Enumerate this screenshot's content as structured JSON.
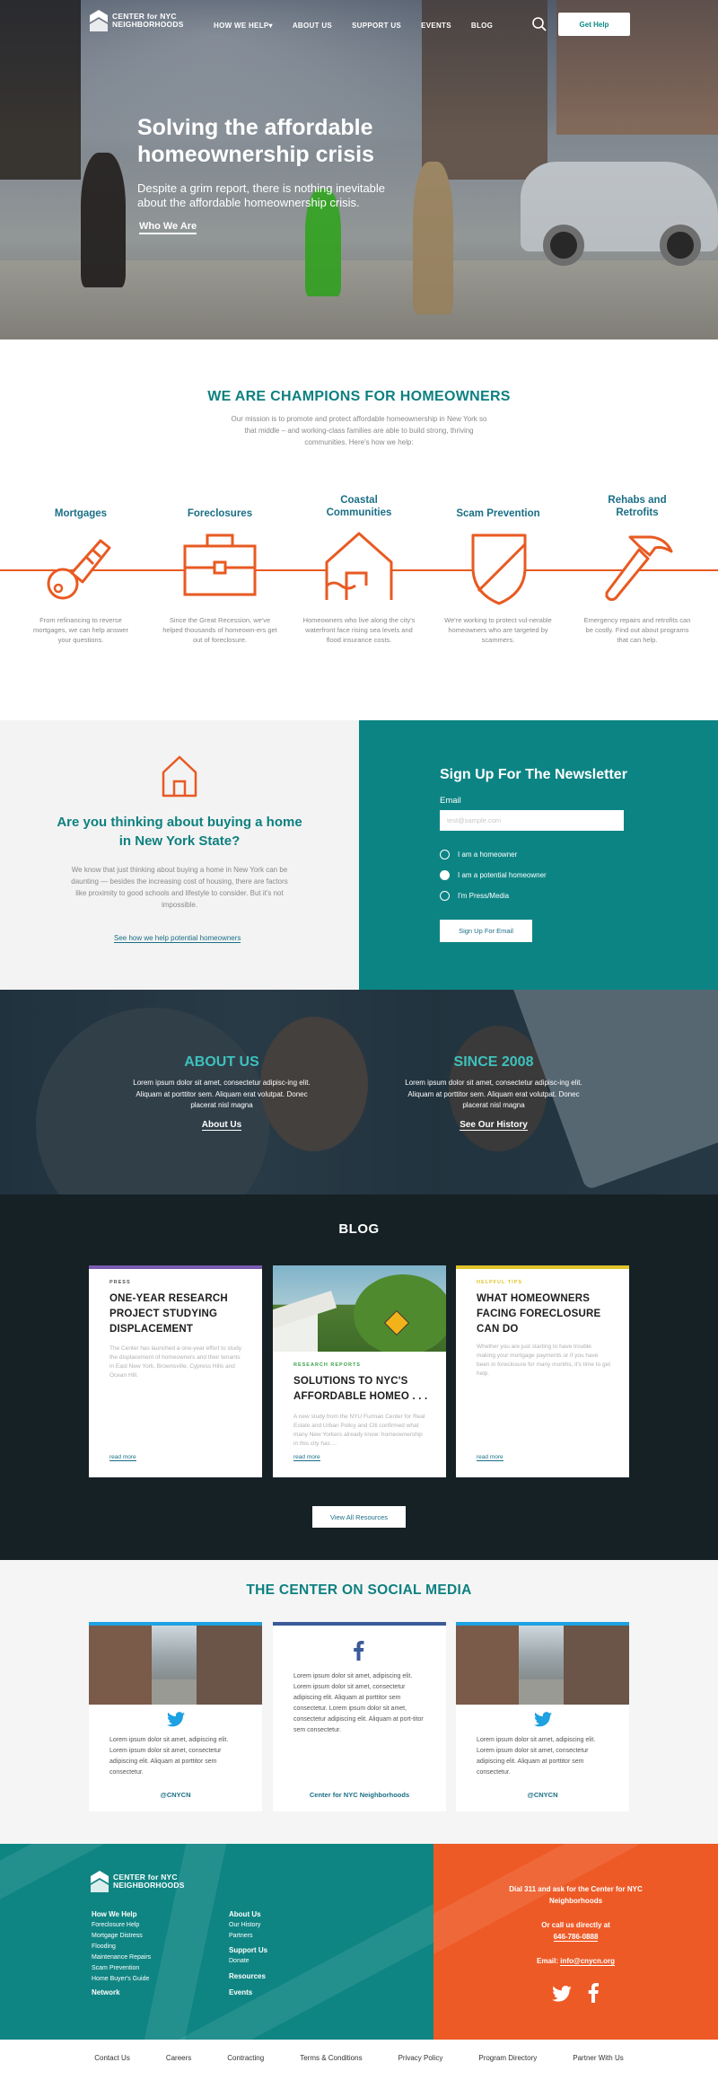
{
  "nav": {
    "logo_line1": "CENTER for NYC",
    "logo_line2": "NEIGHBORHOODS",
    "items": [
      "HOW WE HELP",
      "ABOUT US",
      "SUPPORT US",
      "EVENTS",
      "BLOG"
    ],
    "how_we_help_caret": "▾",
    "cta": "Get Help"
  },
  "hero": {
    "title": "Solving the affordable homeownership crisis",
    "subtitle": "Despite a grim report, there is nothing inevitable about the affordable homeownership crisis.",
    "link": "Who We Are"
  },
  "champions": {
    "title": "WE ARE CHAMPIONS FOR HOMEOWNERS",
    "description": "Our mission is to promote and protect affordable homeownership in New York so that  middle – and working-class families are able to build strong, thriving communities.  Here's how we help:",
    "features": [
      {
        "title": "Mortgages",
        "icon": "key-icon",
        "desc": "From refinancing to reverse mortgages, we can help answer your questions."
      },
      {
        "title": "Foreclosures",
        "icon": "briefcase-icon",
        "desc": "Since the Great Recession, we've helped thousands of homeown-ers get out of foreclosure."
      },
      {
        "title": "Coastal Communities",
        "icon": "house-flood-icon",
        "desc": "Homeowners who live along the city's waterfront face rising sea levels and flood insurance costs."
      },
      {
        "title": "Scam Prevention",
        "icon": "shield-icon",
        "desc": "We're working to protect vul-nerable homeowners who are targeted by scammers."
      },
      {
        "title": "Rehabs and Retrofits",
        "icon": "hammer-icon",
        "desc": "Emergency repairs and retrofits can be costly. Find out about programs that can help."
      }
    ],
    "accent_color": "#e85a22"
  },
  "home_buying": {
    "title": "Are you thinking about buying a home in New York State?",
    "description": "We know that just thinking about buying a home in New York can be daunting — besides the increasing cost of housing, there are factors like proximity to good schools and lifestyle to consider. But it's not impossible.",
    "link": "See how we help potential homeowners"
  },
  "newsletter": {
    "title": "Sign Up For The Newsletter",
    "email_label": "Email",
    "email_placeholder": "test@sample.com",
    "options": [
      {
        "label": "I am a homeowner",
        "selected": false
      },
      {
        "label": "I am a potential homeowner",
        "selected": true
      },
      {
        "label": "I'm Press/Media",
        "selected": false
      }
    ],
    "button": "Sign Up For Email"
  },
  "about": {
    "left": {
      "title": "ABOUT US",
      "desc": "Lorem ipsum dolor sit amet, consectetur adipisc-ing elit. Aliquam at porttitor sem.  Aliquam erat volutpat. Donec placerat nisl magna",
      "link": "About Us"
    },
    "right": {
      "title": "SINCE 2008",
      "desc": "Lorem ipsum dolor sit amet, consectetur adipisc-ing elit. Aliquam at porttitor sem.  Aliquam erat volutpat. Donec placerat nisl magna",
      "link": "See Our History"
    }
  },
  "blog": {
    "title": "BLOG",
    "cards": [
      {
        "tag": "PRESS",
        "tag_color": "#7b5cb0",
        "title": "ONE-YEAR RESEARCH PROJECT STUDYING DISPLACEMENT",
        "text": "The Center has launched a one-year effort to study the displacement of homeowners and their tenants in East New York, Brownsville, Cypress Hills and Ocean Hill.",
        "more": "read more"
      },
      {
        "tag": "RESEARCH REPORTS",
        "tag_color": "#3aa34a",
        "title": "SOLUTIONS TO NYC'S AFFORDABLE HOMEO . . .",
        "text": "A new study from the NYU Furman Center for Real Estate and Urban Policy and Citi confirmed what many New Yorkers already know: homeownership in this city has ...",
        "more": "read more"
      },
      {
        "tag": "HELPFUL TIPS",
        "tag_color": "#e0c32a",
        "title": "WHAT HOMEOWNERS FACING FORECLOSURE CAN DO",
        "text": "Whether you are just starting to have trouble making your mortgage payments or if you have been in foreclosure for many months, it's time to get help.",
        "more": "read more"
      }
    ],
    "view_all": "View All Resources"
  },
  "social": {
    "title": "THE CENTER ON SOCIAL MEDIA",
    "cards": [
      {
        "network": "twitter",
        "bar_color": "#1da1e2",
        "icon": "twitter-icon",
        "text": "Lorem ipsum dolor sit amet, adipiscing elit. Lorem ipsum dolor sit amet, consectetur adipiscing elit. Aliquam at porttitor sem consectetur.",
        "handle": "@CNYCN"
      },
      {
        "network": "facebook",
        "bar_color": "#3b5a99",
        "icon": "facebook-icon",
        "text": "Lorem ipsum dolor sit amet, adipiscing elit. Lorem ipsum dolor sit amet, consectetur adipiscing elit. Aliquam at porttitor sem consectetur. Lorem ipsum dolor sit amet, consectetur adipiscing elit. Aliquam at port-titor sem consectetur.",
        "handle": "Center for NYC Neighborhoods"
      },
      {
        "network": "twitter",
        "bar_color": "#1da1e2",
        "icon": "twitter-icon",
        "text": "Lorem ipsum dolor sit amet, adipiscing elit. Lorem ipsum dolor sit amet, consectetur adipiscing elit. Aliquam at porttitor sem consectetur.",
        "handle": "@CNYCN"
      }
    ]
  },
  "footer": {
    "logo_line1": "CENTER for NYC",
    "logo_line2": "NEIGHBORHOODS",
    "col1_head": "How We Help",
    "col1_items": [
      "Foreclosure Help",
      "Mortgage Distress",
      "Flooding",
      "Maintenance Repairs",
      "Scam Prevention",
      "Home Buyer's Guide"
    ],
    "col1_head2": "Network",
    "col2_head": "About Us",
    "col2_items": [
      "Our History",
      "Partners"
    ],
    "col2_head2": "Support Us",
    "col2_items2": [
      "Donate"
    ],
    "col2_head3": "Resources",
    "col2_head4": "Events",
    "right_line": "Dial 311 and ask for the Center for NYC Neighborhoods",
    "call_line": "Or call us directly at",
    "phone": "646-786-0888",
    "email_label": "Email:",
    "email": "info@cnycn.org"
  },
  "bottom_links": [
    "Contact Us",
    "Careers",
    "Contracting",
    "Terms & Conditions",
    "Privacy Policy",
    "Program Directory",
    "Partner With Us"
  ]
}
